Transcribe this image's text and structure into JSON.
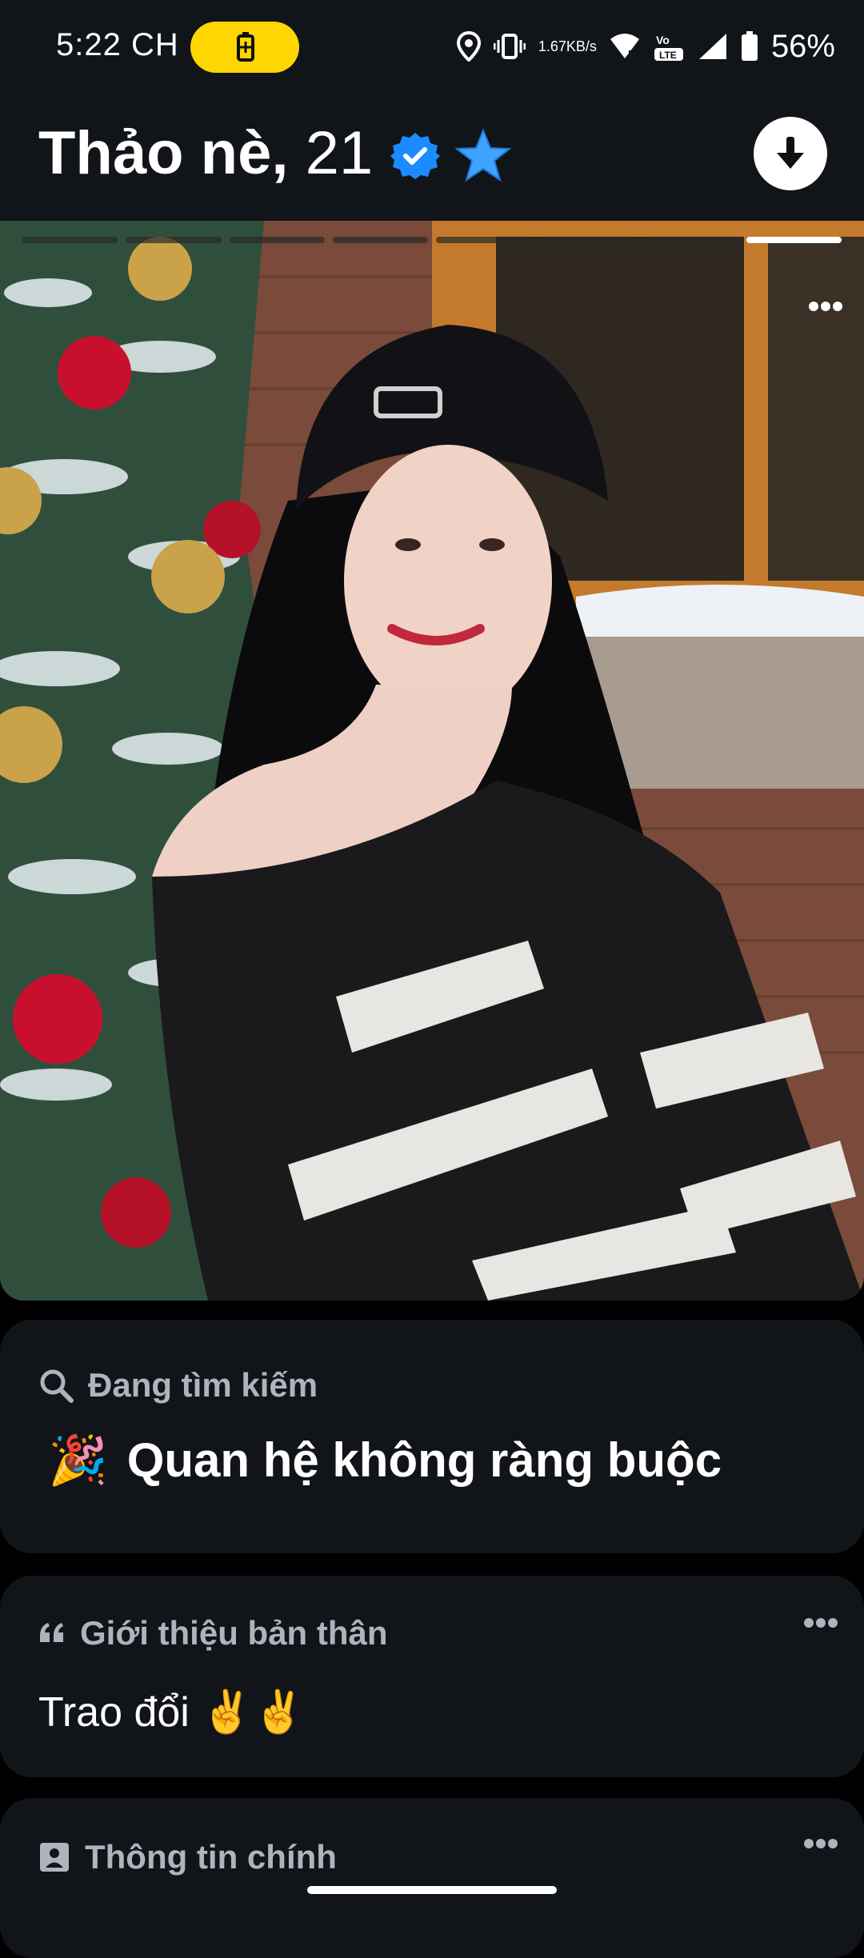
{
  "status_bar": {
    "time": "5:22 CH",
    "netspeed_value": "1.67",
    "netspeed_unit": "KB/s",
    "battery_percent": "56%",
    "icons": [
      "battery-saver-icon",
      "location-icon",
      "vibrate-icon",
      "wifi-icon",
      "volte-lte-icon",
      "signal-icon",
      "battery-icon"
    ]
  },
  "header": {
    "name": "Thảo nè,",
    "age": "21",
    "icons": [
      "verified-badge-icon",
      "star-icon",
      "download-icon"
    ]
  },
  "photo": {
    "progress_segments": 8,
    "active_segment": 8,
    "more_icon": "more-horizontal-icon"
  },
  "search_card": {
    "heading": "Đang tìm kiếm",
    "value_emoji": "🎉",
    "value": "Quan hệ không ràng buộc"
  },
  "intro_card": {
    "heading": "Giới thiệu bản thân",
    "text": "Trao đổi ✌️✌️"
  },
  "info_card": {
    "heading": "Thông tin chính"
  },
  "colors": {
    "background": "#000000",
    "card": "#111418",
    "accent_yellow": "#ffd600",
    "verified_blue": "#1a8cff",
    "heading_gray": "#aeb4bd"
  }
}
